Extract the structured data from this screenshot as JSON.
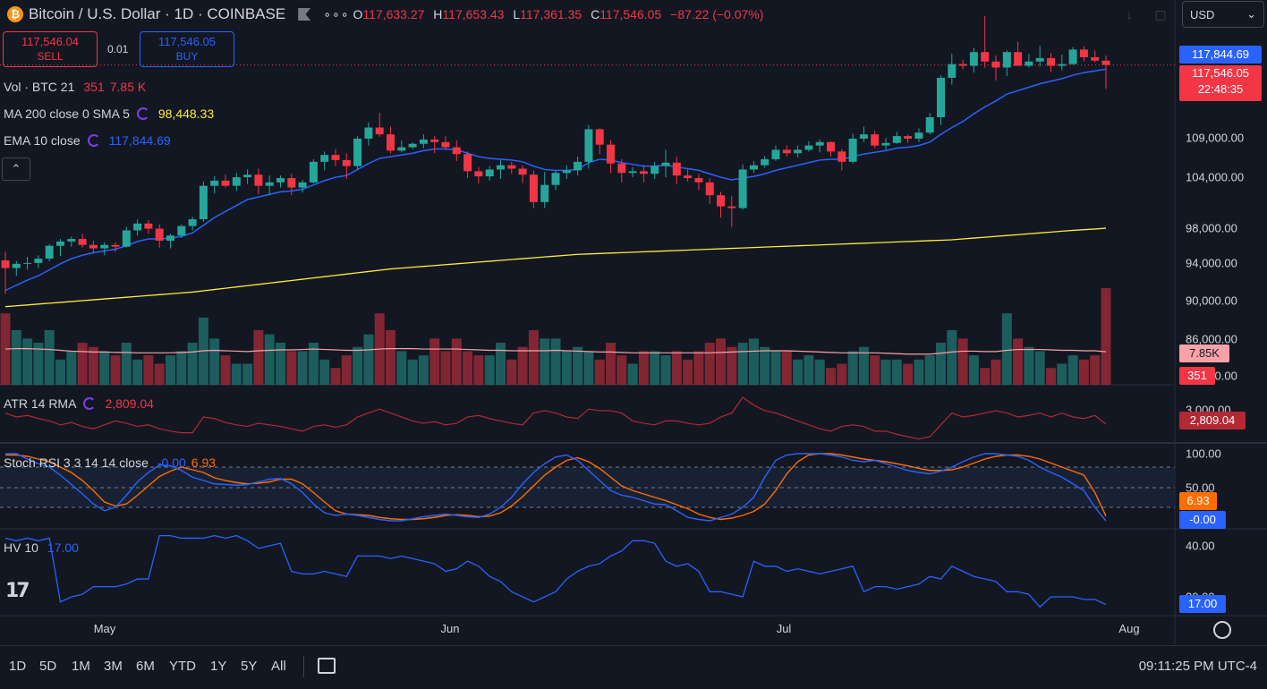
{
  "header": {
    "logo_glyph": "₿",
    "symbol_title": "Bitcoin / U.S. Dollar · 1D · COINBASE",
    "more_glyph": "∘∘∘",
    "ohlc": {
      "o_label": "O",
      "o": "117,633.27",
      "h_label": "H",
      "h": "117,653.43",
      "l_label": "L",
      "l": "117,361.35",
      "c_label": "C",
      "c": "117,546.05",
      "change": "−87.22 (−0.07%)"
    },
    "currency": "USD",
    "currency_caret": "⌄"
  },
  "trade": {
    "sell_price": "117,546.04",
    "sell_label": "SELL",
    "spread": "0.01",
    "buy_price": "117,546.05",
    "buy_label": "BUY"
  },
  "legends": {
    "vol": {
      "name": "Vol · BTC 21",
      "v1": "351",
      "v2": "7.85 K"
    },
    "ma": {
      "name": "MA 200 close 0 SMA 5",
      "value": "98,448.33"
    },
    "ema": {
      "name": "EMA 10 close",
      "value": "117,844.69"
    },
    "collapse_glyph": "⌃",
    "atr": {
      "name": "ATR 14 RMA",
      "value": "2,809.04"
    },
    "stoch": {
      "name": "Stoch RSI 3 3 14 14 close",
      "k": "-0.00",
      "d": "6.93"
    },
    "hv": {
      "name": "HV 10",
      "value": "17.00"
    }
  },
  "price_axis": {
    "ticks": [
      "109,000.00",
      "104,000.00",
      "98,000.00",
      "94,000.00",
      "90,000.00",
      "86,000.00",
      "80,000.00"
    ],
    "ema_label": "117,844.69",
    "last_price": "117,546.05",
    "countdown": "22:48:35",
    "vol_ma_label": "7.85K",
    "vol_label": "351",
    "atr_tick": "3,000.00",
    "atr_label": "2,809.04",
    "stoch_ticks": [
      "100.00",
      "50.00"
    ],
    "stoch_d_label": "6.93",
    "stoch_k_label": "-0.00",
    "hv_ticks": [
      "40.00",
      "20.00"
    ],
    "hv_label": "17.00"
  },
  "time_axis": {
    "ticks": [
      "May",
      "Jun",
      "Jul",
      "Aug"
    ]
  },
  "footer": {
    "ranges": [
      "1D",
      "5D",
      "1M",
      "3M",
      "6M",
      "YTD",
      "1Y",
      "5Y",
      "All"
    ],
    "clock": "09:11:25 PM UTC-4"
  },
  "colors": {
    "up": "#26a69a",
    "down": "#f23645",
    "ema": "#2962ff",
    "ma": "#ffeb3b",
    "atr": "#b22833",
    "stoch_k": "#2962ff",
    "stoch_d": "#ff6d00",
    "hv": "#2962ff",
    "vol_ma": "#f7a2a9"
  },
  "chart_data": {
    "type": "candlestick",
    "title": "Bitcoin / U.S. Dollar · 1D · COINBASE",
    "y_range": [
      80000,
      120000
    ],
    "x_range": [
      "Apr 24",
      "Jul 28"
    ],
    "candles": [
      [
        94700,
        95700,
        90800,
        93800
      ],
      [
        93800,
        94600,
        92900,
        94300
      ],
      [
        94300,
        95100,
        93600,
        94400
      ],
      [
        94400,
        95300,
        93800,
        94900
      ],
      [
        94900,
        96600,
        94600,
        96400
      ],
      [
        96400,
        97200,
        95200,
        96900
      ],
      [
        96900,
        97500,
        96300,
        97200
      ],
      [
        97200,
        97800,
        96200,
        96500
      ],
      [
        96500,
        97000,
        95500,
        96100
      ],
      [
        96100,
        96800,
        95300,
        96500
      ],
      [
        96500,
        96800,
        95700,
        96300
      ],
      [
        96300,
        98600,
        96200,
        98200
      ],
      [
        98200,
        99500,
        97600,
        99000
      ],
      [
        99000,
        99400,
        97800,
        98400
      ],
      [
        98400,
        98900,
        96200,
        97000
      ],
      [
        97000,
        97800,
        96100,
        97600
      ],
      [
        97600,
        98900,
        97300,
        98700
      ],
      [
        98700,
        99800,
        98200,
        99500
      ],
      [
        99500,
        103900,
        99200,
        103400
      ],
      [
        103400,
        104500,
        102500,
        104000
      ],
      [
        104000,
        104700,
        103200,
        103400
      ],
      [
        103400,
        104900,
        102800,
        104400
      ],
      [
        104400,
        105300,
        103600,
        104700
      ],
      [
        104700,
        105400,
        102400,
        103400
      ],
      [
        103400,
        104600,
        102300,
        103800
      ],
      [
        103800,
        104600,
        103200,
        104300
      ],
      [
        104300,
        104800,
        102300,
        103200
      ],
      [
        103200,
        104100,
        102600,
        103800
      ],
      [
        103800,
        106500,
        103700,
        106200
      ],
      [
        106200,
        107400,
        105200,
        107000
      ],
      [
        107000,
        107700,
        105700,
        106400
      ],
      [
        106400,
        107200,
        104200,
        105700
      ],
      [
        105700,
        109200,
        105300,
        108900
      ],
      [
        108900,
        110800,
        108100,
        110200
      ],
      [
        110200,
        111900,
        109100,
        109400
      ],
      [
        109400,
        110300,
        107200,
        107500
      ],
      [
        107500,
        108700,
        107300,
        107900
      ],
      [
        107900,
        108500,
        107700,
        108300
      ],
      [
        108300,
        109400,
        107800,
        108800
      ],
      [
        108800,
        109200,
        107200,
        108500
      ],
      [
        108500,
        109200,
        107600,
        107900
      ],
      [
        107900,
        108700,
        106300,
        107100
      ],
      [
        107100,
        107400,
        104300,
        105100
      ],
      [
        105100,
        105600,
        103700,
        104500
      ],
      [
        104500,
        105700,
        104000,
        105300
      ],
      [
        105300,
        106400,
        104200,
        105800
      ],
      [
        105800,
        106200,
        104800,
        105400
      ],
      [
        105400,
        105800,
        103700,
        104700
      ],
      [
        104700,
        105200,
        100800,
        101500
      ],
      [
        101500,
        105000,
        100800,
        103500
      ],
      [
        103500,
        105200,
        102900,
        104900
      ],
      [
        104900,
        105800,
        104200,
        105200
      ],
      [
        105200,
        106800,
        104600,
        106200
      ],
      [
        106200,
        110500,
        105400,
        110000
      ],
      [
        110000,
        110100,
        107100,
        108200
      ],
      [
        108200,
        108700,
        104900,
        106000
      ],
      [
        106000,
        106500,
        103800,
        104900
      ],
      [
        104900,
        105600,
        104400,
        105100
      ],
      [
        105100,
        105800,
        103800,
        104800
      ],
      [
        104800,
        106200,
        104200,
        105700
      ],
      [
        105700,
        107600,
        104400,
        106100
      ],
      [
        106100,
        106800,
        103600,
        104600
      ],
      [
        104600,
        105300,
        103900,
        104300
      ],
      [
        104300,
        104800,
        102900,
        103800
      ],
      [
        103800,
        104300,
        101300,
        102300
      ],
      [
        102300,
        102700,
        99700,
        101000
      ],
      [
        101000,
        102200,
        98600,
        100800
      ],
      [
        100800,
        105900,
        100600,
        105300
      ],
      [
        105300,
        106300,
        104900,
        105800
      ],
      [
        105800,
        106900,
        105500,
        106500
      ],
      [
        106500,
        108100,
        106300,
        107600
      ],
      [
        107600,
        108100,
        106800,
        107200
      ],
      [
        107200,
        108100,
        106700,
        107600
      ],
      [
        107600,
        108600,
        107400,
        108100
      ],
      [
        108100,
        108800,
        107300,
        108500
      ],
      [
        108500,
        108600,
        106800,
        107400
      ],
      [
        107400,
        107700,
        105200,
        106200
      ],
      [
        106200,
        109500,
        106000,
        108900
      ],
      [
        108900,
        110300,
        108500,
        109400
      ],
      [
        109400,
        109800,
        107800,
        108100
      ],
      [
        108100,
        109000,
        107600,
        108400
      ],
      [
        108400,
        109700,
        108300,
        109200
      ],
      [
        109200,
        109400,
        108400,
        108900
      ],
      [
        108900,
        110100,
        108500,
        109600
      ],
      [
        109600,
        111900,
        109400,
        111400
      ],
      [
        111400,
        116300,
        110500,
        116000
      ],
      [
        116000,
        118800,
        115200,
        117600
      ],
      [
        117600,
        118100,
        117000,
        117400
      ],
      [
        117400,
        119500,
        116600,
        119000
      ],
      [
        119000,
        123200,
        117200,
        117900
      ],
      [
        117900,
        118600,
        115700,
        117200
      ],
      [
        117200,
        119200,
        116200,
        119000
      ],
      [
        119000,
        120200,
        117600,
        117400
      ],
      [
        117400,
        118800,
        117200,
        117900
      ],
      [
        117900,
        119700,
        117300,
        118300
      ],
      [
        118300,
        118900,
        116700,
        117400
      ],
      [
        117400,
        118700,
        116900,
        117600
      ],
      [
        117600,
        119600,
        117500,
        119300
      ],
      [
        119300,
        119700,
        117900,
        118400
      ],
      [
        118400,
        119200,
        117800,
        118000
      ],
      [
        118000,
        118600,
        114700,
        117500
      ]
    ],
    "ema10": [
      91200,
      91800,
      92400,
      92900,
      93600,
      94300,
      94900,
      95300,
      95600,
      95800,
      96000,
      96400,
      96900,
      97200,
      97200,
      97300,
      97500,
      97900,
      98800,
      99700,
      100400,
      101100,
      101800,
      102100,
      102400,
      102700,
      102800,
      103000,
      103500,
      104000,
      104400,
      104600,
      105300,
      106000,
      106600,
      106800,
      107000,
      107200,
      107500,
      107700,
      107700,
      107600,
      107200,
      106800,
      106600,
      106500,
      106400,
      106200,
      105700,
      105300,
      105200,
      105200,
      105300,
      106100,
      106500,
      106400,
      106100,
      105900,
      105700,
      105700,
      105800,
      105600,
      105400,
      105200,
      104800,
      104400,
      104100,
      104300,
      104500,
      104800,
      105200,
      105500,
      105800,
      106100,
      106400,
      106500,
      106500,
      106800,
      107100,
      107300,
      107500,
      107800,
      107900,
      108100,
      108500,
      109400,
      110200,
      110900,
      111800,
      112600,
      113300,
      114100,
      114500,
      114900,
      115300,
      115600,
      115900,
      116300,
      116600,
      116800,
      117000
    ],
    "ma200": [
      89300,
      89400,
      89500,
      89600,
      89700,
      89800,
      89900,
      90000,
      90100,
      90200,
      90300,
      90400,
      90500,
      90600,
      90700,
      90800,
      90900,
      91000,
      91150,
      91300,
      91450,
      91600,
      91750,
      91900,
      92050,
      92200,
      92350,
      92500,
      92650,
      92800,
      92950,
      93100,
      93250,
      93400,
      93550,
      93700,
      93800,
      93900,
      94000,
      94100,
      94200,
      94300,
      94400,
      94500,
      94600,
      94700,
      94800,
      94900,
      95000,
      95100,
      95200,
      95300,
      95400,
      95450,
      95500,
      95550,
      95600,
      95650,
      95700,
      95750,
      95800,
      95850,
      95900,
      95950,
      96000,
      96050,
      96100,
      96150,
      96200,
      96250,
      96300,
      96350,
      96400,
      96450,
      96500,
      96550,
      96600,
      96650,
      96700,
      96750,
      96800,
      96850,
      96900,
      96950,
      97000,
      97050,
      97100,
      97200,
      97300,
      97400,
      97500,
      97600,
      97700,
      97800,
      97900,
      98000,
      98100,
      98200,
      98280,
      98360,
      98448
    ],
    "volume": [
      17,
      13,
      11,
      10,
      13,
      6,
      8,
      10,
      9,
      8,
      7,
      10,
      6,
      7,
      5,
      7,
      8,
      10,
      16,
      11,
      7,
      5,
      5,
      13,
      12,
      10,
      8,
      8,
      10,
      6,
      4,
      7,
      9,
      12,
      17,
      13,
      8,
      6,
      7,
      11,
      8,
      11,
      8,
      7,
      7,
      10,
      6,
      9,
      13,
      11,
      11,
      8,
      9,
      8,
      6,
      10,
      7,
      5,
      8,
      8,
      7,
      8,
      6,
      8,
      10,
      11,
      9,
      10,
      11,
      9,
      8,
      8,
      6,
      7,
      6,
      4,
      5,
      8,
      9,
      7,
      6,
      6,
      5,
      6,
      7,
      10,
      13,
      11,
      7,
      4,
      6,
      17,
      11,
      9,
      8,
      4,
      5,
      7,
      6,
      7,
      23
    ],
    "vol_ma": [
      8.5,
      8.6,
      8.6,
      8.5,
      8.4,
      8.2,
      8,
      7.9,
      7.8,
      7.8,
      7.7,
      7.7,
      7.6,
      7.6,
      7.6,
      7.6,
      7.7,
      7.8,
      8.1,
      8.2,
      8.1,
      8,
      7.9,
      8.1,
      8.2,
      8.3,
      8.3,
      8.4,
      8.5,
      8.4,
      8.3,
      8.2,
      8.2,
      8.3,
      8.5,
      8.6,
      8.6,
      8.6,
      8.5,
      8.5,
      8.5,
      8.5,
      8.4,
      8.3,
      8.2,
      8.2,
      8.1,
      8.1,
      8.1,
      8.1,
      8.2,
      8.1,
      8,
      7.9,
      7.8,
      7.8,
      7.7,
      7.6,
      7.6,
      7.6,
      7.6,
      7.6,
      7.6,
      7.6,
      7.6,
      7.7,
      7.8,
      7.9,
      8,
      8.1,
      8.1,
      8.1,
      8,
      7.9,
      7.8,
      7.7,
      7.6,
      7.6,
      7.6,
      7.6,
      7.5,
      7.4,
      7.3,
      7.3,
      7.3,
      7.5,
      7.8,
      8,
      8,
      7.9,
      7.9,
      8.2,
      8.4,
      8.4,
      8.4,
      8.3,
      8.2,
      8.2,
      8.1,
      8.1,
      7.85
    ],
    "atr": [
      2.95,
      2.9,
      2.92,
      2.88,
      2.85,
      2.8,
      2.83,
      2.78,
      2.75,
      2.8,
      2.85,
      2.82,
      2.78,
      2.8,
      2.75,
      2.72,
      2.7,
      2.7,
      2.9,
      2.88,
      2.83,
      2.8,
      2.78,
      2.82,
      2.8,
      2.78,
      2.75,
      2.72,
      2.78,
      2.8,
      2.77,
      2.8,
      2.9,
      2.95,
      3,
      2.95,
      2.9,
      2.85,
      2.82,
      2.84,
      2.8,
      2.82,
      2.9,
      2.92,
      2.88,
      2.85,
      2.82,
      2.8,
      2.95,
      2.98,
      2.95,
      2.9,
      2.88,
      3,
      2.98,
      2.98,
      2.95,
      2.85,
      2.82,
      2.8,
      2.85,
      2.85,
      2.82,
      2.8,
      2.82,
      2.9,
      2.95,
      3.15,
      3.05,
      2.98,
      2.95,
      2.9,
      2.85,
      2.8,
      2.75,
      2.72,
      2.78,
      2.8,
      2.78,
      2.72,
      2.72,
      2.68,
      2.65,
      2.62,
      2.65,
      2.8,
      2.95,
      2.9,
      2.92,
      2.95,
      2.98,
      2.95,
      2.9,
      2.92,
      2.95,
      2.9,
      2.95,
      2.9,
      2.88,
      2.92,
      2.809
    ],
    "stoch_k": [
      100,
      100,
      92,
      85,
      80,
      68,
      54,
      40,
      25,
      15,
      20,
      38,
      58,
      72,
      83,
      82,
      75,
      65,
      60,
      55,
      54,
      53,
      54,
      58,
      62,
      63,
      55,
      42,
      25,
      12,
      8,
      10,
      8,
      5,
      2,
      0,
      0,
      3,
      6,
      8,
      10,
      8,
      6,
      5,
      10,
      20,
      35,
      55,
      72,
      85,
      95,
      98,
      90,
      75,
      60,
      45,
      38,
      35,
      30,
      25,
      24,
      15,
      5,
      2,
      0,
      5,
      10,
      20,
      35,
      65,
      90,
      98,
      100,
      100,
      100,
      98,
      95,
      90,
      88,
      90,
      85,
      80,
      75,
      72,
      70,
      74,
      80,
      88,
      95,
      100,
      100,
      98,
      96,
      90,
      80,
      72,
      65,
      55,
      45,
      20,
      -0.0
    ],
    "stoch_d": [
      98,
      98,
      96,
      92,
      88,
      80,
      72,
      60,
      45,
      28,
      22,
      25,
      38,
      52,
      66,
      74,
      80,
      76,
      72,
      64,
      60,
      57,
      55,
      56,
      58,
      62,
      62,
      55,
      42,
      28,
      15,
      10,
      9,
      8,
      5,
      3,
      2,
      2,
      3,
      5,
      8,
      9,
      8,
      6,
      7,
      12,
      22,
      36,
      52,
      68,
      80,
      90,
      94,
      88,
      78,
      65,
      52,
      45,
      40,
      35,
      30,
      24,
      18,
      10,
      5,
      2,
      4,
      8,
      14,
      25,
      45,
      70,
      88,
      98,
      100,
      100,
      98,
      95,
      92,
      90,
      88,
      85,
      82,
      78,
      75,
      75,
      76,
      80,
      86,
      92,
      96,
      98,
      98,
      96,
      92,
      86,
      80,
      74,
      68,
      42,
      6.93
    ],
    "hv": [
      43,
      42,
      43,
      42,
      43,
      18,
      20,
      21,
      24,
      24,
      24,
      25,
      27,
      27,
      44,
      44,
      43,
      43,
      43,
      44,
      43,
      44,
      42,
      39,
      40,
      41,
      30,
      29,
      29,
      30,
      29,
      28,
      36,
      36,
      36,
      35,
      36,
      35,
      34,
      33,
      30,
      31,
      34,
      32,
      28,
      26,
      22,
      20,
      18,
      20,
      22,
      27,
      30,
      32,
      33,
      36,
      38,
      42,
      42,
      41,
      34,
      32,
      33,
      30,
      22,
      22,
      21,
      20,
      34,
      32,
      32,
      30,
      31,
      30,
      29,
      30,
      31,
      32,
      22,
      24,
      24,
      23,
      24,
      25,
      28,
      27,
      32,
      30,
      28,
      27,
      26,
      22,
      22,
      21,
      16,
      20,
      20,
      20,
      19,
      19,
      17
    ]
  }
}
